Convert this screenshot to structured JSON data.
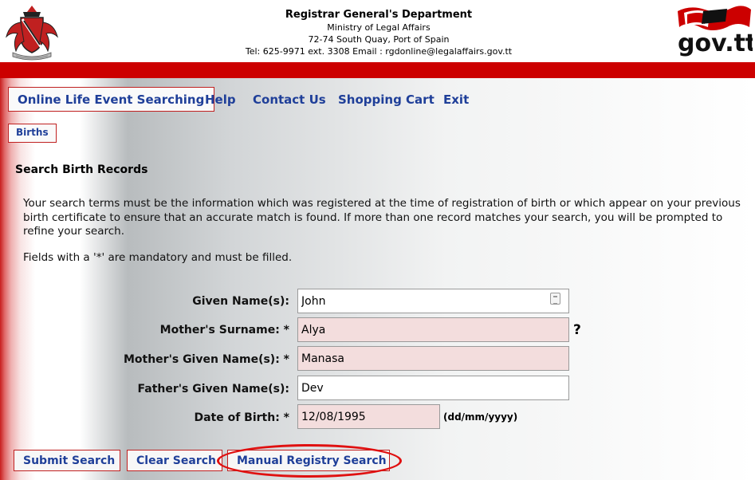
{
  "header": {
    "title": "Registrar General's Department",
    "ministry": "Ministry of Legal Affairs",
    "address": "72-74 South Quay, Port of Spain",
    "contact": "Tel: 625-9971 ext. 3308 Email : rgdonline@legalaffairs.gov.tt",
    "logo_text": "gov.tt"
  },
  "nav": {
    "items": [
      {
        "label": "Online Life Event Searching"
      },
      {
        "label": "Help"
      },
      {
        "label": "Contact Us"
      },
      {
        "label": "Shopping Cart"
      },
      {
        "label": "Exit"
      }
    ],
    "subtab": "Births"
  },
  "page": {
    "title": "Search Birth Records",
    "intro": "Your search terms must be the information which was registered at the time of registration of birth or which appear on your previous birth certificate to ensure that an accurate match is found. If more than one record matches your search, you will be prompted to refine your search.",
    "mandatory_note": "Fields with a '*' are mandatory and must be filled."
  },
  "form": {
    "given_names": {
      "label": "Given Name(s):",
      "value": "John"
    },
    "mother_surname": {
      "label": "Mother's Surname: *",
      "value": "Alya",
      "help": "?"
    },
    "mother_given": {
      "label": "Mother's Given Name(s): *",
      "value": "Manasa"
    },
    "father_given": {
      "label": "Father's Given Name(s):",
      "value": "Dev"
    },
    "dob": {
      "label": "Date of Birth: *",
      "value": "12/08/1995",
      "hint": "(dd/mm/yyyy)"
    }
  },
  "buttons": {
    "submit": "Submit Search",
    "clear": "Clear Search",
    "manual": "Manual Registry Search"
  },
  "colors": {
    "brand_red": "#cc0000",
    "link_blue": "#1f3f99",
    "required_field": "#f3dddd",
    "annotation": "#e01010"
  }
}
